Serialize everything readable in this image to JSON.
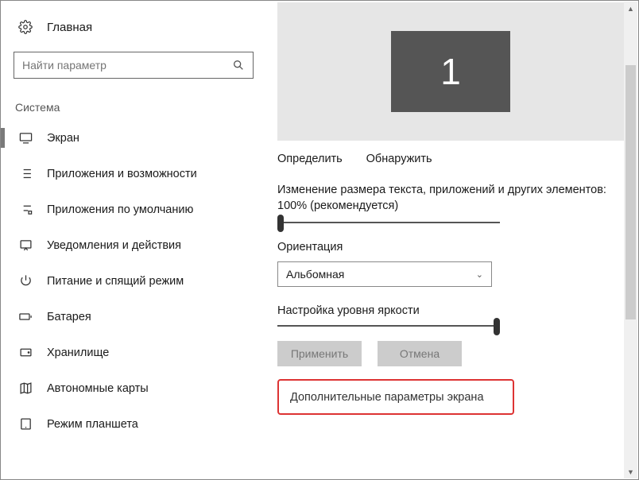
{
  "sidebar": {
    "home": "Главная",
    "search_placeholder": "Найти параметр",
    "category": "Система",
    "items": [
      {
        "label": "Экран"
      },
      {
        "label": "Приложения и возможности"
      },
      {
        "label": "Приложения по умолчанию"
      },
      {
        "label": "Уведомления и действия"
      },
      {
        "label": "Питание и спящий режим"
      },
      {
        "label": "Батарея"
      },
      {
        "label": "Хранилище"
      },
      {
        "label": "Автономные карты"
      },
      {
        "label": "Режим планшета"
      }
    ]
  },
  "main": {
    "monitor_number": "1",
    "identify": "Определить",
    "detect": "Обнаружить",
    "scaling_text": "Изменение размера текста, приложений и других элементов: 100% (рекомендуется)",
    "orientation_label": "Ориентация",
    "orientation_value": "Альбомная",
    "brightness_label": "Настройка уровня яркости",
    "apply": "Применить",
    "cancel": "Отмена",
    "advanced": "Дополнительные параметры экрана"
  }
}
